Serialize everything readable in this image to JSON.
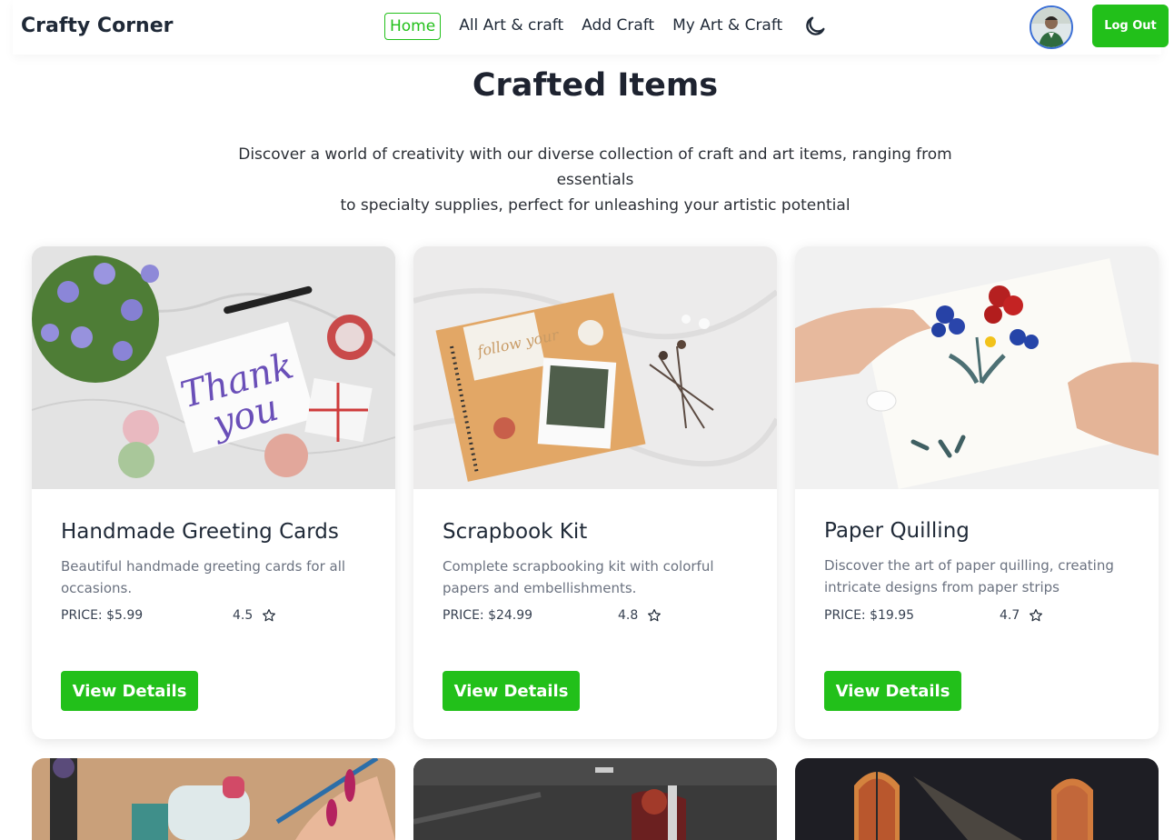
{
  "nav": {
    "brand": "Crafty Corner",
    "links": [
      {
        "label": "Home",
        "active": true
      },
      {
        "label": "All Art & craft",
        "active": false
      },
      {
        "label": "Add Craft",
        "active": false
      },
      {
        "label": "My Art & Craft",
        "active": false
      }
    ],
    "theme_toggle_icon": "moon-icon",
    "logout_label": "Log Out"
  },
  "header": {
    "title": "Crafted Items",
    "subtitle_line1": "Discover a world of creativity with our diverse collection of craft and art items, ranging from essentials",
    "subtitle_line2": "to specialty supplies, perfect for unleashing your artistic potential"
  },
  "cards": [
    {
      "title": "Handmade Greeting Cards",
      "desc": "Beautiful handmade greeting cards for all occasions.",
      "price": "PRICE: $5.99",
      "rating": "4.5",
      "button": "View Details"
    },
    {
      "title": "Scrapbook Kit",
      "desc": "Complete scrapbooking kit with colorful papers and embellishments.",
      "price": "PRICE: $24.99",
      "rating": "4.8",
      "button": "View Details"
    },
    {
      "title": "Paper Quilling",
      "desc": "Discover the art of paper quilling, creating intricate designs from paper strips",
      "price": "PRICE: $19.95",
      "rating": "4.7",
      "button": "View Details"
    }
  ],
  "colors": {
    "accent": "#22c01a",
    "text": "#1f2937",
    "muted": "#6b7280"
  }
}
